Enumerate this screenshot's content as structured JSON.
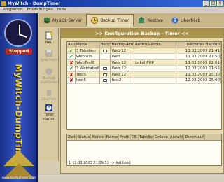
{
  "window": {
    "title": "MyWitch - DumpTimer"
  },
  "menu": [
    "Programm",
    "Einstellungen",
    "Hilfe"
  ],
  "sidebar": {
    "status": "Stopped",
    "title": "MyWitch-DumpTimer",
    "url": "www.DumpTimer.com"
  },
  "tabs": [
    {
      "label": "MySQL Server",
      "active": false
    },
    {
      "label": "Backup Timer",
      "active": true
    },
    {
      "label": "Restore",
      "active": false
    },
    {
      "label": "Überblick",
      "active": false
    }
  ],
  "tools": [
    {
      "label": "Neu",
      "enabled": true
    },
    {
      "label": "Speichern",
      "enabled": false
    },
    {
      "label": "Backup ausführen",
      "enabled": false
    },
    {
      "label": "Löschen",
      "enabled": false
    },
    {
      "label": "Timer starten",
      "enabled": true
    }
  ],
  "banner": ">> Konfiguration Backup - Timer <<",
  "grid": {
    "headers": [
      "Aktiv",
      "Name",
      "Bench",
      "Backup-Profil",
      "Restore-Profil",
      "Nächstes Backup"
    ],
    "rows": [
      {
        "active": true,
        "name": "3 Tabellen",
        "bench": true,
        "profile": "Web 12",
        "restore": "",
        "next": "11.03.2003 21:41"
      },
      {
        "active": true,
        "name": "Webtest",
        "bench": false,
        "profile": "Web",
        "restore": "",
        "next": "11.03.2003 21:50"
      },
      {
        "active": false,
        "name": "WebTest8",
        "bench": false,
        "profile": "Web 12",
        "restore": "Lokal PHP",
        "next": "11.03.2003 22:01"
      },
      {
        "active": true,
        "name": "3 Webtabellen",
        "bench": true,
        "profile": "Web 12",
        "restore": "",
        "next": "12.03.2003 01:55"
      },
      {
        "active": false,
        "name": "Test5",
        "bench": true,
        "profile": "Web 12",
        "restore": "",
        "next": "11.03.2003 23:30"
      },
      {
        "active": false,
        "name": "test6",
        "bench": true,
        "profile": "test2",
        "restore": "",
        "next": "12.03.2003 05:00"
      }
    ]
  },
  "log": {
    "headers": [
      "Zeit",
      "Status",
      "Aktion",
      "Name",
      "Profil",
      "DB",
      "Tabelle",
      "Grösse",
      "Anzahl",
      "Durchlauf"
    ],
    "entry": {
      "num": "1",
      "time": "11.03.2003 21:39:53 ->",
      "msg": "Initilized"
    }
  },
  "colors": {
    "titlebar": "#0b2a8c",
    "banner": "#a8914a",
    "sidebar": "#2a44b0",
    "ok": "#1a9a1a",
    "error": "#d01010"
  }
}
